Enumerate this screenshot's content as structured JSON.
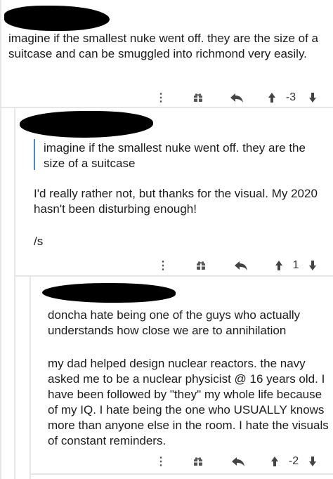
{
  "comments": [
    {
      "author": "",
      "body": "imagine if the smallest nuke went off. they are the size of a suitcase and can be smuggled into richmond very easily.",
      "score": "-3"
    },
    {
      "author": "",
      "quote": "imagine if the smallest nuke went off. they are the size of a suitcase",
      "body": "I'd really rather not, but thanks for the visual. My 2020 hasn't been disturbing enough!",
      "body2": "/s",
      "score": "1"
    },
    {
      "author": "",
      "body": "doncha hate being one of the guys who actually understands how close we are to annihilation",
      "body2": "my dad helped design nuclear reactors.   the navy asked me to be a nuclear physicist @ 16 years old.   I have been followed by \"they\" my whole life because of my IQ.   I hate being the one who USUALLY knows more than anyone else in the room.   I hate the visuals of constant reminders.",
      "score": "-2"
    }
  ],
  "icons": [
    "more-dots-icon",
    "gift-icon",
    "reply-icon",
    "upvote-icon",
    "downvote-icon"
  ]
}
